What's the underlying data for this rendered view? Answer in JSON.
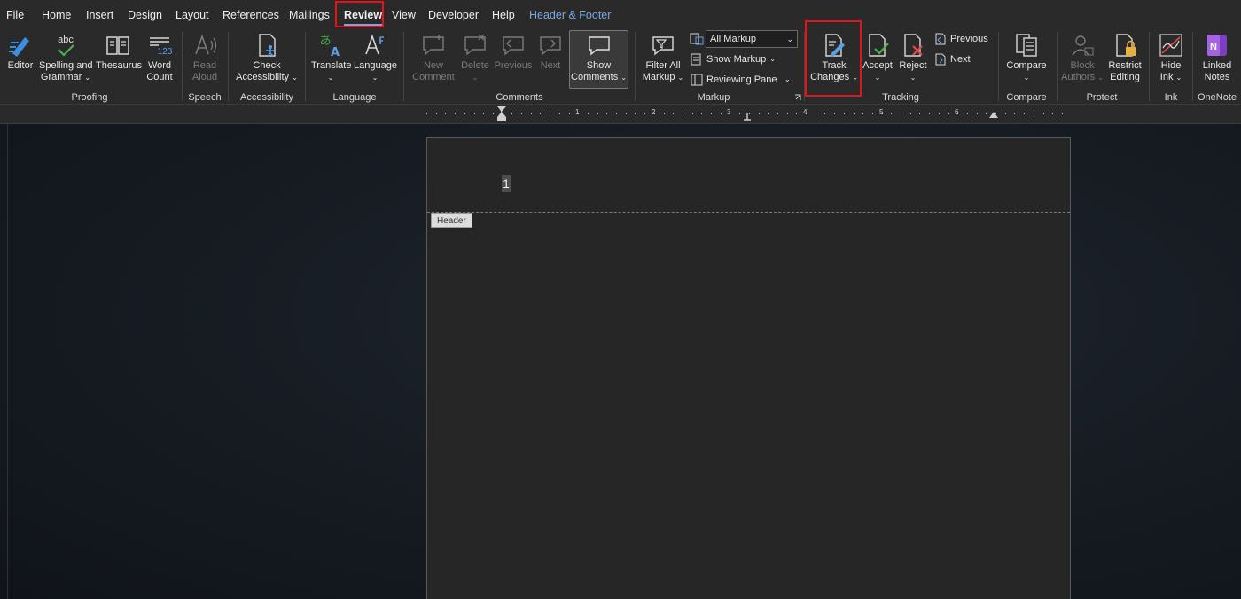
{
  "menu": {
    "tabs": [
      "File",
      "Home",
      "Insert",
      "Design",
      "Layout",
      "References",
      "Mailings",
      "Review",
      "View",
      "Developer",
      "Help",
      "Header & Footer"
    ],
    "active": "Review"
  },
  "ribbon": {
    "proofing": {
      "editor": "Editor",
      "spelling_1": "Spelling and",
      "spelling_2": "Grammar",
      "thesaurus": "Thesaurus",
      "word_count_1": "Word",
      "word_count_2": "Count",
      "abc_text": "abc",
      "num_text": "123",
      "label": "Proofing"
    },
    "speech": {
      "read_1": "Read",
      "read_2": "Aloud",
      "label": "Speech"
    },
    "accessibility": {
      "check_1": "Check",
      "check_2": "Accessibility",
      "label": "Accessibility"
    },
    "language": {
      "translate": "Translate",
      "language": "Language",
      "label": "Language"
    },
    "comments": {
      "new_1": "New",
      "new_2": "Comment",
      "delete": "Delete",
      "previous": "Previous",
      "next": "Next",
      "show_1": "Show",
      "show_2": "Comments",
      "label": "Comments"
    },
    "markup": {
      "filter_1": "Filter All",
      "filter_2": "Markup",
      "dropdown_value": "All Markup",
      "show_markup": "Show Markup",
      "reviewing_pane": "Reviewing Pane",
      "label": "Markup"
    },
    "tracking": {
      "track_1": "Track",
      "track_2": "Changes",
      "accept": "Accept",
      "reject": "Reject",
      "previous": "Previous",
      "next": "Next",
      "label": "Tracking"
    },
    "compare": {
      "compare": "Compare",
      "label": "Compare"
    },
    "protect": {
      "block_1": "Block",
      "block_2": "Authors",
      "restrict_1": "Restrict",
      "restrict_2": "Editing",
      "label": "Protect"
    },
    "ink": {
      "hide_1": "Hide",
      "hide_2": "Ink",
      "label": "Ink"
    },
    "onenote": {
      "linked_1": "Linked",
      "linked_2": "Notes",
      "label": "OneNote"
    }
  },
  "ruler": {
    "numbers": [
      "1",
      "1",
      "2",
      "3",
      "4",
      "5",
      "6"
    ]
  },
  "document": {
    "page_number": "1",
    "header_tag": "Header"
  },
  "colors": {
    "highlight": "#e3141a",
    "accent": "#7aa8e6"
  }
}
